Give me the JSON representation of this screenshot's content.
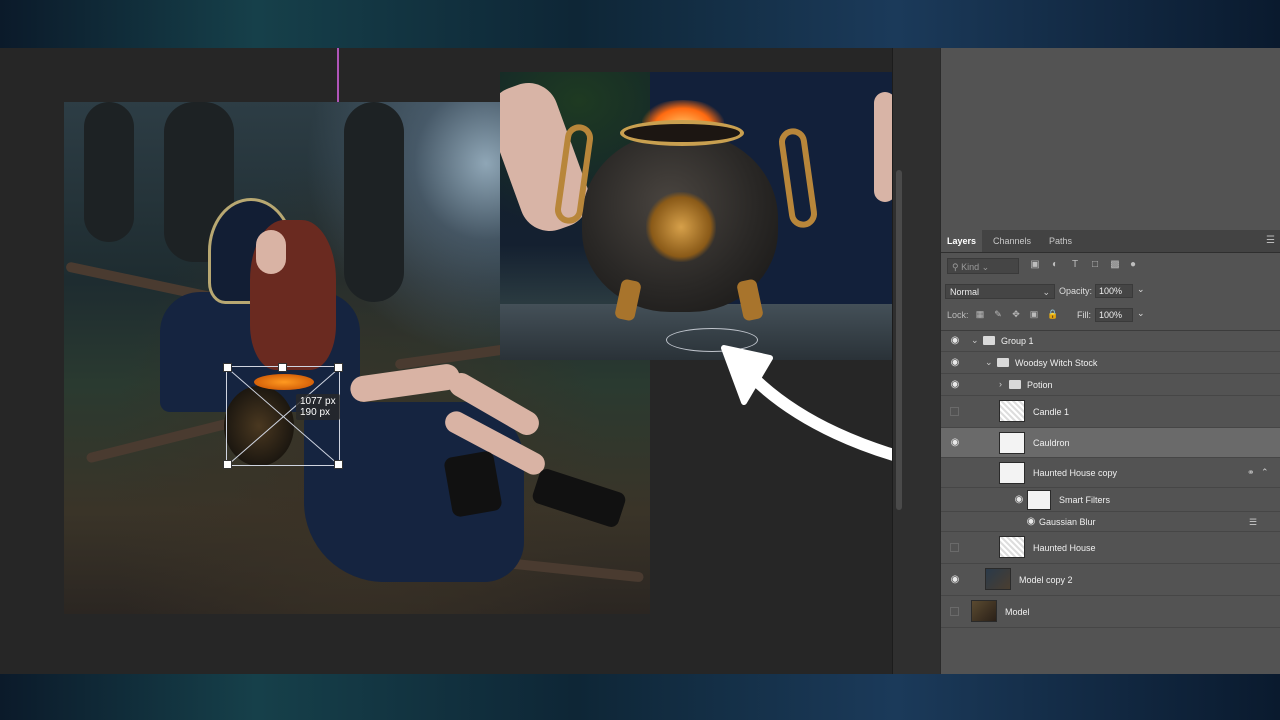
{
  "tooltip": {
    "width": "1077 px",
    "height": "190 px"
  },
  "layers_panel": {
    "tabs": [
      "Layers",
      "Channels",
      "Paths"
    ],
    "filter_placeholder": "Kind",
    "filter_icons": [
      "image-filter-icon",
      "adjustment-filter-icon",
      "type-filter-icon",
      "shape-filter-icon",
      "smart-object-filter-icon",
      "filter-toggle-icon"
    ],
    "blend_mode": "Normal",
    "opacity_label": "Opacity:",
    "opacity_value": "100%",
    "lock_label": "Lock:",
    "fill_label": "Fill:",
    "fill_value": "100%",
    "layers": [
      {
        "name": "Group 1",
        "type": "group",
        "visible": true,
        "expanded": true
      },
      {
        "name": "Woodsy Witch Stock",
        "type": "group",
        "visible": true,
        "expanded": true
      },
      {
        "name": "Potion",
        "type": "group",
        "visible": true,
        "expanded": false
      },
      {
        "name": "Candle 1",
        "type": "layer",
        "visible": false
      },
      {
        "name": "Cauldron",
        "type": "smart-object",
        "visible": true,
        "selected": true
      },
      {
        "name": "Haunted House copy",
        "type": "smart-object",
        "visible": false
      },
      {
        "name": "Smart Filters",
        "type": "smart-filters",
        "visible": true
      },
      {
        "name": "Gaussian Blur",
        "type": "filter",
        "visible": true
      },
      {
        "name": "Haunted House",
        "type": "layer",
        "visible": false
      },
      {
        "name": "Model copy 2",
        "type": "layer",
        "visible": true
      },
      {
        "name": "Model",
        "type": "layer",
        "visible": false
      }
    ]
  },
  "colors": {
    "guide": "#b055b8",
    "panel": "#535353",
    "selected_row": "#6a6a6a",
    "annotation_arrow": "#ffffff"
  }
}
